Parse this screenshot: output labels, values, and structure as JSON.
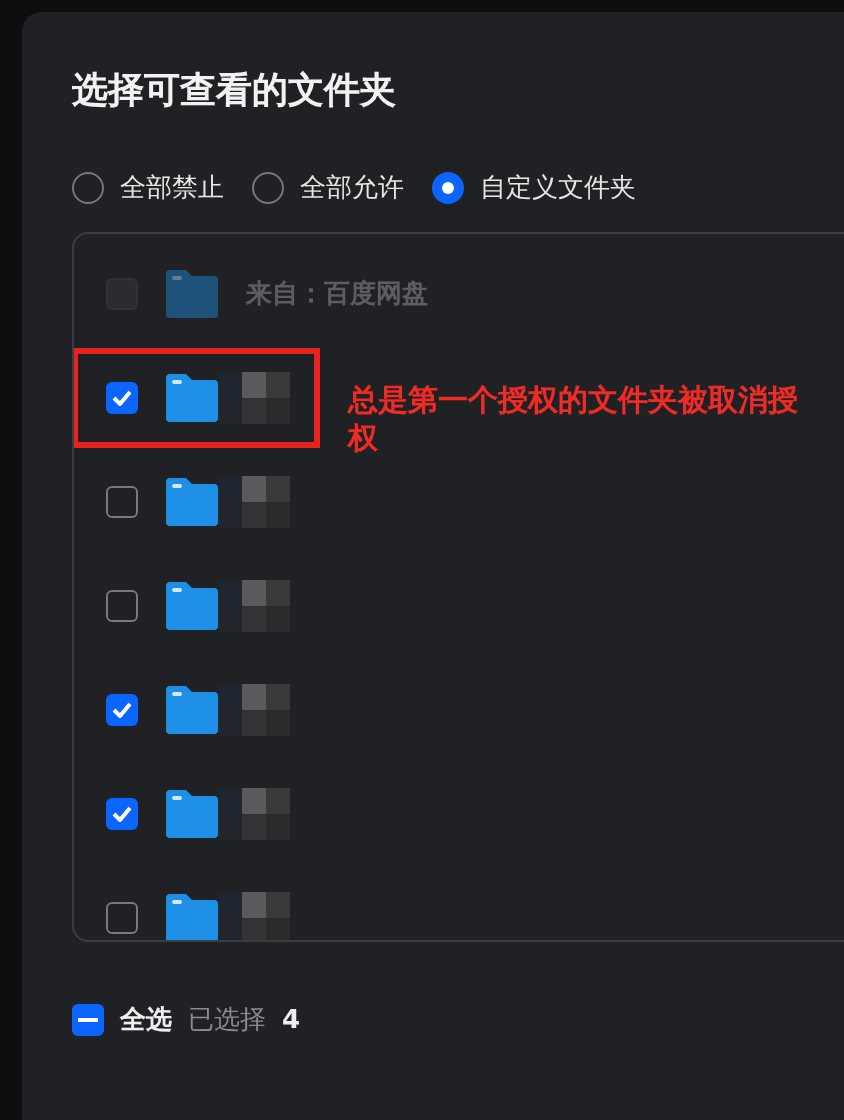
{
  "dialog": {
    "title": "选择可查看的文件夹"
  },
  "modes": [
    {
      "label": "全部禁止",
      "selected": false
    },
    {
      "label": "全部允许",
      "selected": false
    },
    {
      "label": "自定义文件夹",
      "selected": true
    }
  ],
  "folders": [
    {
      "kind": "source",
      "label": "来自：百度网盘",
      "disabled": true,
      "checked": false,
      "highlighted": false
    },
    {
      "kind": "folder",
      "checked": true,
      "highlighted": true
    },
    {
      "kind": "folder",
      "checked": false
    },
    {
      "kind": "folder",
      "checked": false
    },
    {
      "kind": "folder",
      "checked": true
    },
    {
      "kind": "folder",
      "checked": true
    },
    {
      "kind": "folder",
      "checked": false
    }
  ],
  "annotation": {
    "text": "总是第一个授权的文件夹被取消授权"
  },
  "footer": {
    "select_all": {
      "label": "全选",
      "indeterminate": true
    },
    "selected_label": "已选择",
    "selected_count": "4"
  }
}
